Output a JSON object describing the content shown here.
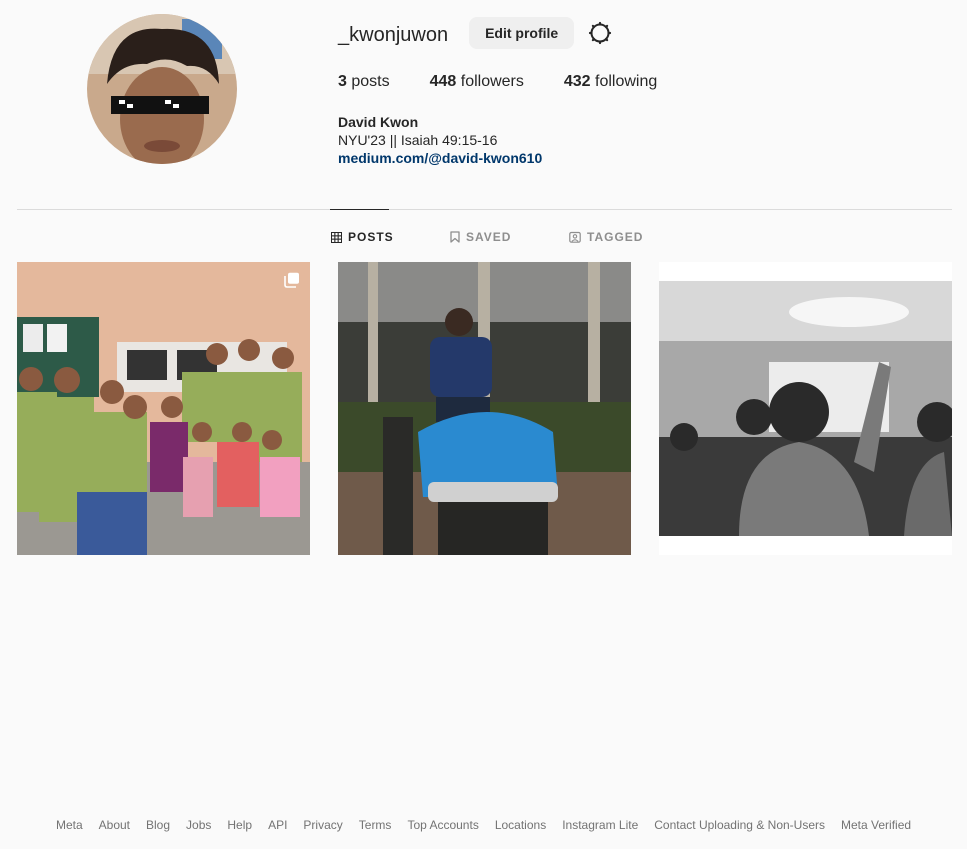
{
  "profile": {
    "username": "_kwonjuwon",
    "edit_label": "Edit profile",
    "posts_count": "3",
    "posts_label": " posts",
    "followers_count": "448",
    "followers_label": " followers",
    "following_count": "432",
    "following_label": " following",
    "name": "David Kwon",
    "bio": "NYU'23 || Isaiah 49:15-16",
    "link": "medium.com/@david-kwon610",
    "avatar_icon": "avatar"
  },
  "tabs": [
    {
      "label": "POSTS",
      "icon": "grid-icon",
      "active": true
    },
    {
      "label": "SAVED",
      "icon": "bookmark-icon",
      "active": false
    },
    {
      "label": "TAGGED",
      "icon": "tag-icon",
      "active": false
    }
  ],
  "posts": [
    {
      "type": "carousel",
      "icon": "multiple-posts-icon"
    },
    {
      "type": "photo"
    },
    {
      "type": "photo"
    }
  ],
  "footer": [
    "Meta",
    "About",
    "Blog",
    "Jobs",
    "Help",
    "API",
    "Privacy",
    "Terms",
    "Top Accounts",
    "Locations",
    "Instagram Lite",
    "Contact Uploading & Non-Users",
    "Meta Verified"
  ],
  "colors": {
    "background": "#fafafa",
    "text": "#262626",
    "muted": "#737373",
    "link": "#00376b",
    "button": "#efefef"
  }
}
